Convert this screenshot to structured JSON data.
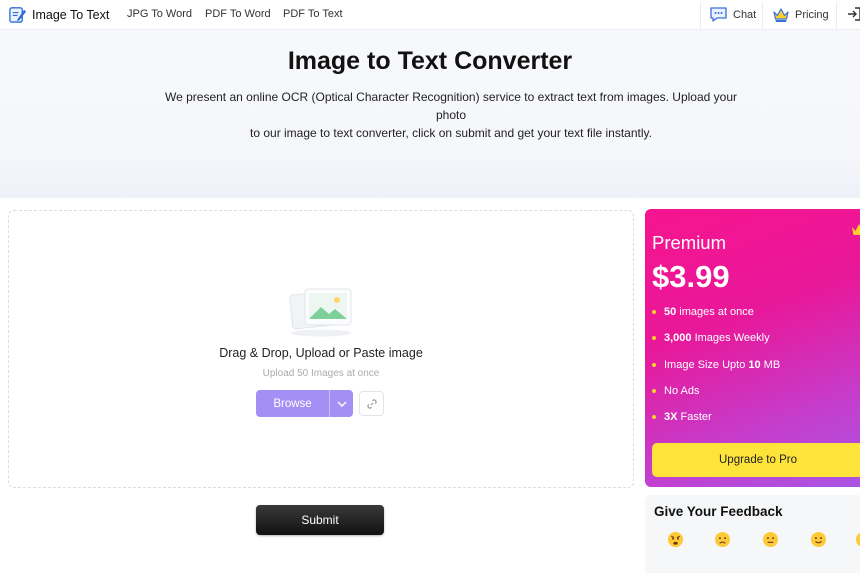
{
  "header": {
    "logo_text": "Image To Text",
    "nav": [
      "JPG To Word",
      "PDF To Word",
      "PDF To Text"
    ],
    "chat_label": "Chat",
    "pricing_label": "Pricing"
  },
  "hero": {
    "title": "Image to Text Converter",
    "description_line1": "We present an online OCR (Optical Character Recognition) service to extract text from images. Upload your photo",
    "description_line2": "to our image to text converter, click on submit and get your text file instantly."
  },
  "upload": {
    "title": "Drag & Drop, Upload or Paste image",
    "subtitle": "Upload 50 Images at once",
    "browse_label": "Browse",
    "browse_color": "#a48ff4"
  },
  "submit_label": "Submit",
  "premium": {
    "label": "Premium",
    "price": "$3.99",
    "features": [
      {
        "bold": "50",
        "text": " images at once"
      },
      {
        "bold": "3,000",
        "text": " Images Weekly"
      },
      {
        "prefix": "Image Size Upto ",
        "bold": "10",
        "text": " MB"
      },
      {
        "text": "No Ads"
      },
      {
        "bold": "3X",
        "text": " Faster"
      }
    ],
    "upgrade_label": "Upgrade to Pro",
    "gradient_start": "#f7148f",
    "gradient_end": "#a955e4",
    "button_color": "#fde33a"
  },
  "feedback": {
    "title": "Give Your Feedback",
    "emojis": [
      "angry-face-icon",
      "crying-face-icon",
      "neutral-face-icon",
      "smiling-face-icon",
      "happy-face-icon"
    ]
  }
}
